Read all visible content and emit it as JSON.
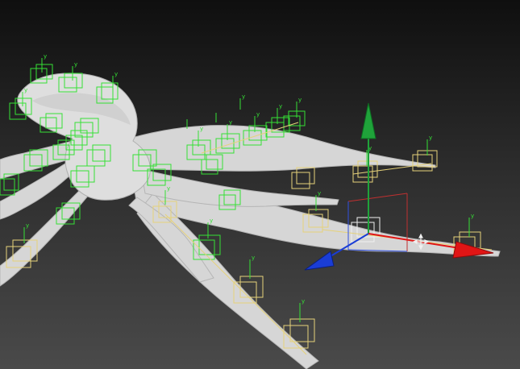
{
  "viewport": {
    "background_top": "#0f0f0f",
    "background_bottom": "#4a4a4a"
  },
  "model": {
    "mesh_color": "#d9d9d9",
    "mesh_shadow": "#9e9e9e"
  },
  "rig": {
    "bone_box_color": "#35e035",
    "selected_bone_color": "#e6d27a",
    "joint_axis_label": "y"
  },
  "gizmo": {
    "x_axis_color": "#e01515",
    "y_axis_color": "#1fa33a",
    "z_axis_color": "#1a3dd6",
    "cursor_icon": "move-cursor-icon"
  }
}
